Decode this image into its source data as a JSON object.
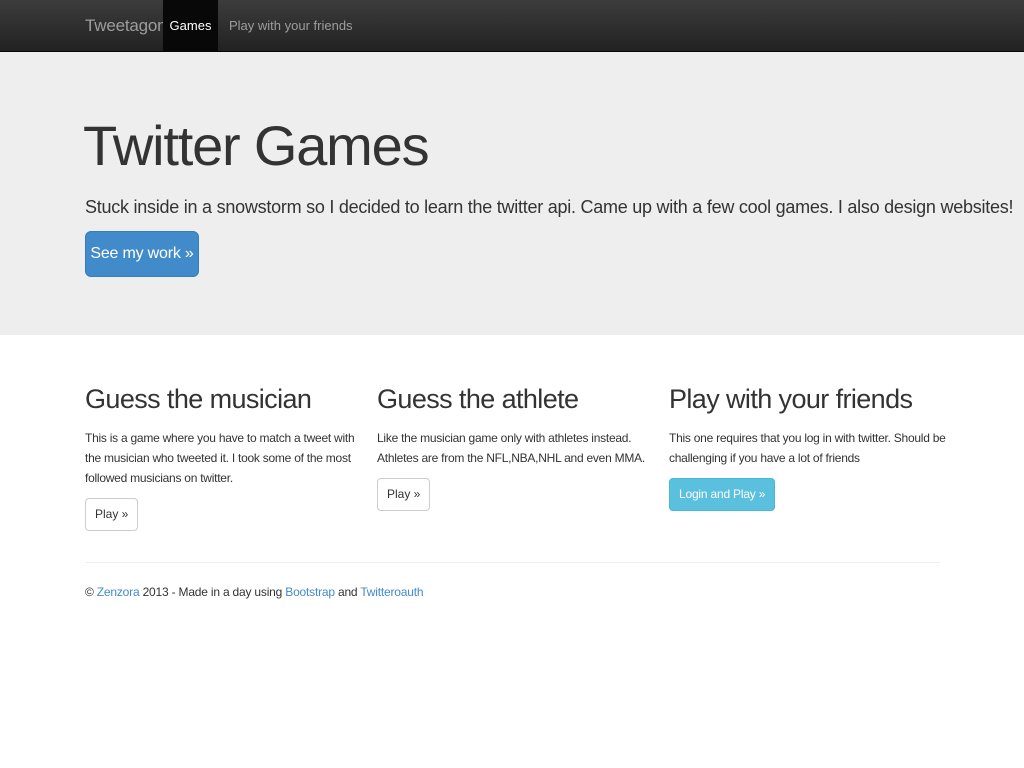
{
  "navbar": {
    "brand": "Tweetagon",
    "items": [
      {
        "label": "Games",
        "active": true
      },
      {
        "label": "Play with your friends",
        "active": false
      }
    ]
  },
  "jumbotron": {
    "title": "Twitter Games",
    "lead": "Stuck inside in a snowstorm so I decided to learn the twitter api. Came up with a few cool games. I also design websites!",
    "button_label": "See my work »"
  },
  "games": [
    {
      "title": "Guess the musician",
      "description": "This is a game where you have to match a tweet with the musician who tweeted it. I took some of the most followed musicians on twitter.",
      "button_label": "Play »"
    },
    {
      "title": "Guess the athlete",
      "description": "Like the musician game only with athletes instead. Athletes are from the NFL,NBA,NHL and even MMA.",
      "button_label": "Play »"
    },
    {
      "title": "Play with your friends",
      "description": "This one requires that you log in with twitter. Should be challenging if you have a lot of friends",
      "button_label": "Login and Play »"
    }
  ],
  "footer": {
    "copyright": "©",
    "author_link": "Zenzora",
    "text_mid": "2013 - Made in a day using",
    "bootstrap_link": "Bootstrap",
    "and": "and",
    "twitteroauth_link": "Twitteroauth"
  },
  "colors": {
    "navbar_bg": "#222222",
    "jumbotron_bg": "#eeeeee",
    "primary": "#428bca",
    "info": "#5bc0de",
    "link": "#428bca"
  }
}
